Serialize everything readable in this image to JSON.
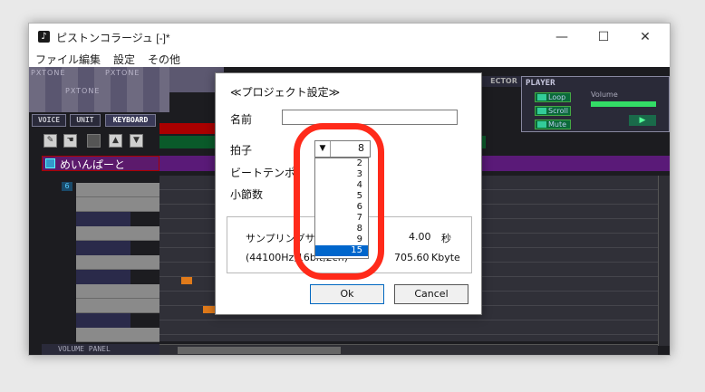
{
  "window": {
    "title": "ピストンコラージュ [-]*",
    "icon_glyph": "♪",
    "controls": {
      "minimize": "—",
      "maximize": "☐",
      "close": "✕"
    }
  },
  "menu": [
    "ファイル",
    "編集",
    "設定",
    "その他"
  ],
  "workspace": {
    "logo_text": "PXTONE",
    "tabs": [
      "VOICE",
      "UNIT",
      "KEYBOARD"
    ],
    "selector_label": "ECTOR",
    "unit_name": "めいんぱーと",
    "octave": "6",
    "note_c": "C",
    "volume_panel": "VOLUME PANEL"
  },
  "player": {
    "title": "PLAYER",
    "buttons": [
      "Loop",
      "Scroll",
      "Mute"
    ],
    "volume_label": "Volume",
    "play_glyph": "▶"
  },
  "dialog": {
    "title": "≪プロジェクト設定≫",
    "name_label": "名前",
    "name_value": "",
    "beat_label": "拍子",
    "beat_value": "8",
    "beat_options": [
      "2",
      "3",
      "4",
      "5",
      "6",
      "7",
      "8",
      "9",
      "15"
    ],
    "beat_selected": "15",
    "tempo_label": "ビートテンポ",
    "measures_label": "小節数",
    "size_label": "サンプリングサイズ",
    "size_value": "4.00",
    "size_unit": "秒",
    "format_label": "(44100Hz,16bit,2ch)",
    "format_value": "705.60",
    "format_unit": "Kbyte",
    "ok_label": "Ok",
    "cancel_label": "Cancel"
  },
  "colors": {
    "accent": "#0066cc",
    "marker": "#ff2a1a",
    "note": "#e07a1a"
  }
}
